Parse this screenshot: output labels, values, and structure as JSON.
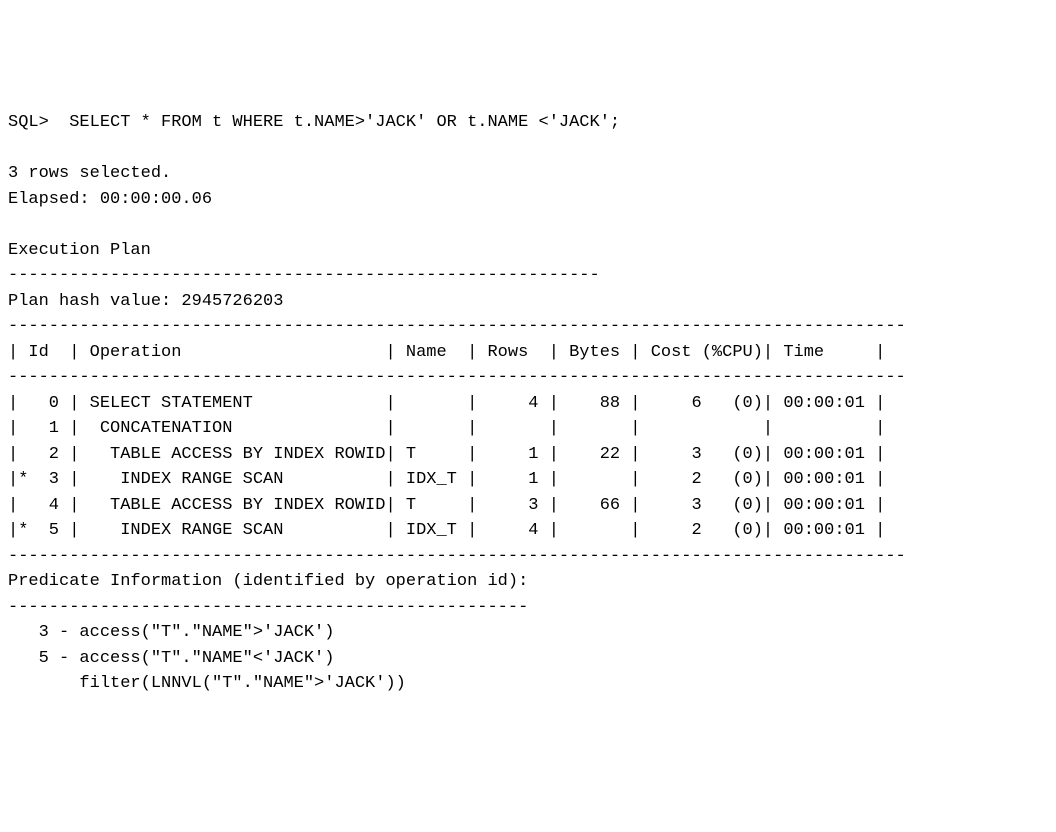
{
  "prompt_line": "SQL>  SELECT * FROM t WHERE t.NAME>'JACK' OR t.NAME <'JACK';",
  "rows_selected": "3 rows selected.",
  "elapsed": "Elapsed: 00:00:00.06",
  "execution_plan_heading": "Execution Plan",
  "rule1": "----------------------------------------------------------",
  "plan_hash": "Plan hash value: 2945726203",
  "rule_long": "----------------------------------------------------------------------------------------",
  "header_line": "| Id  | Operation                    | Name  | Rows  | Bytes | Cost (%CPU)| Time     |",
  "row0": "|   0 | SELECT STATEMENT             |       |     4 |    88 |     6   (0)| 00:00:01 |",
  "row1": "|   1 |  CONCATENATION               |       |       |       |            |          |",
  "row2": "|   2 |   TABLE ACCESS BY INDEX ROWID| T     |     1 |    22 |     3   (0)| 00:00:01 |",
  "row3": "|*  3 |    INDEX RANGE SCAN          | IDX_T |     1 |       |     2   (0)| 00:00:01 |",
  "row4": "|   4 |   TABLE ACCESS BY INDEX ROWID| T     |     3 |    66 |     3   (0)| 00:00:01 |",
  "row5": "|*  5 |    INDEX RANGE SCAN          | IDX_T |     4 |       |     2   (0)| 00:00:01 |",
  "pred_heading": "Predicate Information (identified by operation id):",
  "pred_rule": "---------------------------------------------------",
  "pred_line1": "   3 - access(\"T\".\"NAME\">'JACK')",
  "pred_line2": "   5 - access(\"T\".\"NAME\"<'JACK')",
  "pred_line3": "       filter(LNNVL(\"T\".\"NAME\">'JACK'))",
  "chart_data": {
    "type": "table",
    "columns": [
      "Id",
      "Operation",
      "Name",
      "Rows",
      "Bytes",
      "Cost (%CPU)",
      "Time"
    ],
    "rows": [
      [
        0,
        "SELECT STATEMENT",
        "",
        4,
        88,
        "6   (0)",
        "00:00:01"
      ],
      [
        1,
        " CONCATENATION",
        "",
        null,
        null,
        "",
        ""
      ],
      [
        2,
        "  TABLE ACCESS BY INDEX ROWID",
        "T",
        1,
        22,
        "3   (0)",
        "00:00:01"
      ],
      [
        3,
        "   INDEX RANGE SCAN",
        "IDX_T",
        1,
        null,
        "2   (0)",
        "00:00:01"
      ],
      [
        4,
        "  TABLE ACCESS BY INDEX ROWID",
        "T",
        3,
        66,
        "3   (0)",
        "00:00:01"
      ],
      [
        5,
        "   INDEX RANGE SCAN",
        "IDX_T",
        4,
        null,
        "2   (0)",
        "00:00:01"
      ]
    ]
  }
}
